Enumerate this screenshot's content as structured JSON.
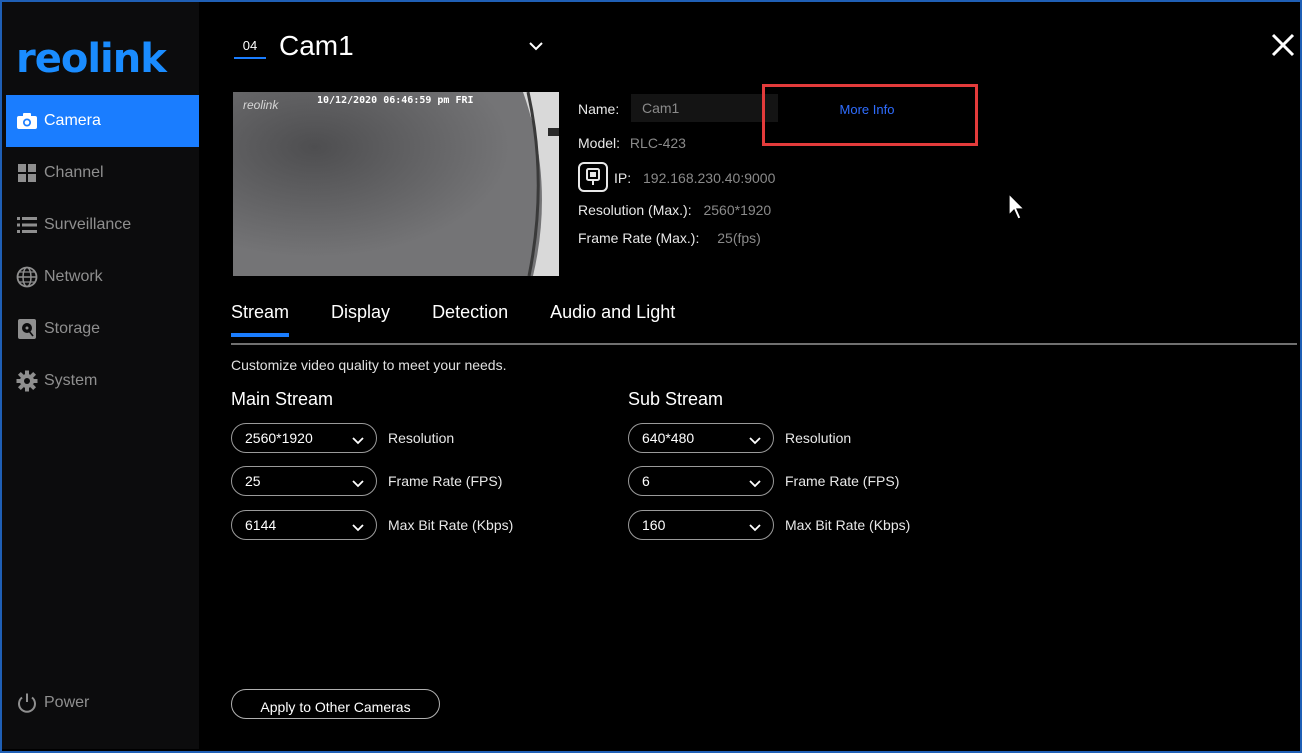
{
  "brand": {
    "logo_text": "reolink"
  },
  "sidebar": {
    "items": [
      {
        "label": "Camera",
        "icon": "camera-icon",
        "active": true
      },
      {
        "label": "Channel",
        "icon": "grid-icon",
        "active": false
      },
      {
        "label": "Surveillance",
        "icon": "list-icon",
        "active": false
      },
      {
        "label": "Network",
        "icon": "globe-icon",
        "active": false
      },
      {
        "label": "Storage",
        "icon": "storage-icon",
        "active": false
      },
      {
        "label": "System",
        "icon": "gear-icon",
        "active": false
      }
    ],
    "power_label": "Power"
  },
  "header": {
    "channel_number": "04",
    "camera_name": "Cam1"
  },
  "preview": {
    "logo_text": "reolink",
    "osd_text": "10/12/2020 06:46:59 pm FRI"
  },
  "info": {
    "name_label": "Name:",
    "name_value": "Cam1",
    "more_info_label": "More Info",
    "model_label": "Model:",
    "model_value": "RLC-423",
    "ip_label": "IP:",
    "ip_value": "192.168.230.40:9000",
    "resolution_label": "Resolution (Max.):",
    "resolution_value": "2560*1920",
    "framerate_label": "Frame Rate (Max.):",
    "framerate_value": "25(fps)"
  },
  "tabs": [
    {
      "label": "Stream",
      "active": true
    },
    {
      "label": "Display",
      "active": false
    },
    {
      "label": "Detection",
      "active": false
    },
    {
      "label": "Audio and Light",
      "active": false
    }
  ],
  "description": "Customize video quality to meet your needs.",
  "main_stream": {
    "title": "Main Stream",
    "resolution": "2560*1920",
    "frame_rate": "25",
    "max_bit_rate": "6144"
  },
  "sub_stream": {
    "title": "Sub Stream",
    "resolution": "640*480",
    "frame_rate": "6",
    "max_bit_rate": "160"
  },
  "labels": {
    "resolution": "Resolution",
    "frame_rate": "Frame Rate (FPS)",
    "max_bit_rate": "Max Bit Rate (Kbps)"
  },
  "apply_button": "Apply to Other Cameras",
  "colors": {
    "accent": "#1a7dff",
    "highlight_box": "#e33b3b",
    "link": "#2f6dff"
  }
}
